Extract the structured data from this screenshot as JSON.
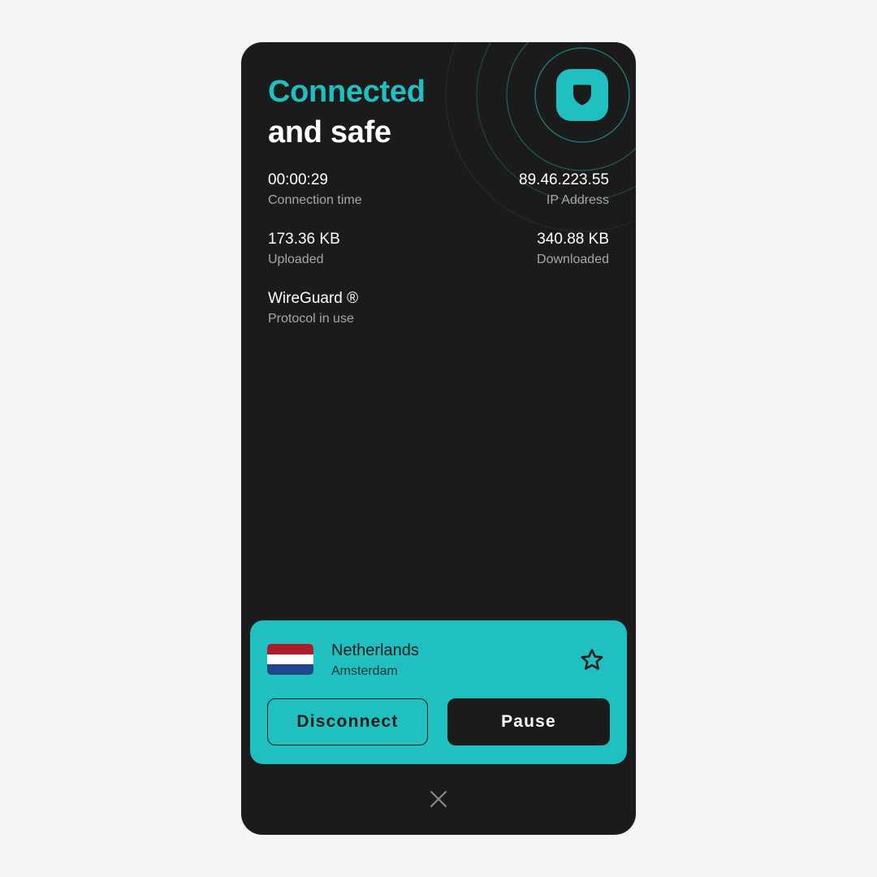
{
  "header": {
    "title_line1": "Connected",
    "title_line2": "and safe"
  },
  "stats": {
    "connection_time": {
      "value": "00:00:29",
      "label": "Connection time"
    },
    "ip_address": {
      "value": "89.46.223.55",
      "label": "IP Address"
    },
    "uploaded": {
      "value": "173.36 KB",
      "label": "Uploaded"
    },
    "downloaded": {
      "value": "340.88 KB",
      "label": "Downloaded"
    },
    "protocol": {
      "value": "WireGuard ®",
      "label": "Protocol in use"
    }
  },
  "location_card": {
    "country": "Netherlands",
    "city": "Amsterdam",
    "flag": [
      "#ae1c28",
      "#ffffff",
      "#21468b"
    ],
    "favorite_icon": "star-icon",
    "disconnect_label": "Disconnect",
    "pause_label": "Pause"
  },
  "colors": {
    "accent": "#21c0c0",
    "background": "#1b1b1c"
  },
  "icons": {
    "status": "shield-icon",
    "close": "close-icon"
  }
}
